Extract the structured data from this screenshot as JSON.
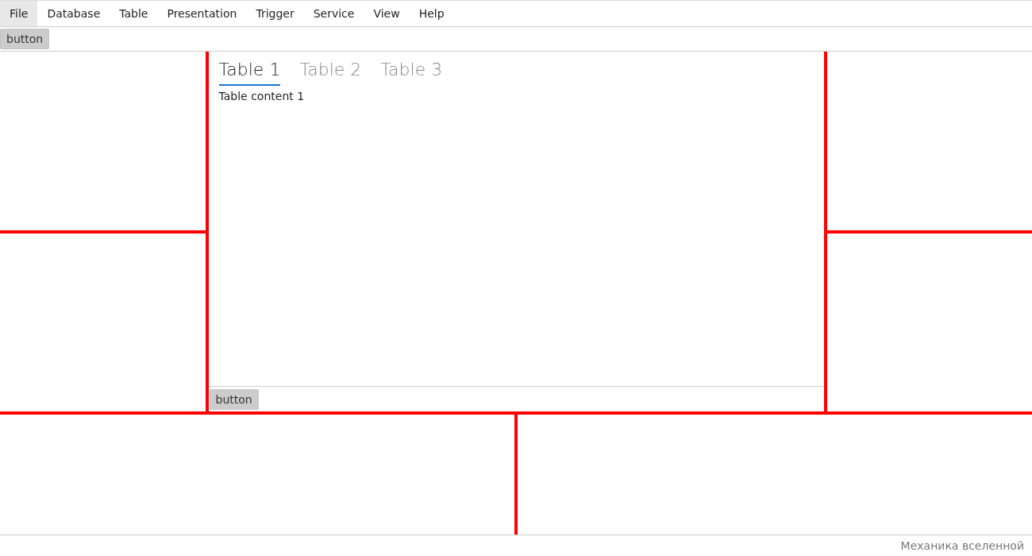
{
  "menu": [
    {
      "label": "File",
      "selected": true
    },
    {
      "label": "Database",
      "selected": false
    },
    {
      "label": "Table",
      "selected": false
    },
    {
      "label": "Presentation",
      "selected": false
    },
    {
      "label": "Trigger",
      "selected": false
    },
    {
      "label": "Service",
      "selected": false
    },
    {
      "label": "View",
      "selected": false
    },
    {
      "label": "Help",
      "selected": false
    }
  ],
  "toolbar": {
    "button": "button"
  },
  "tabs": [
    {
      "label": "Table 1",
      "selected": true
    },
    {
      "label": "Table 2",
      "selected": false
    },
    {
      "label": "Table 3",
      "selected": false
    }
  ],
  "tab_content": "Table content 1",
  "center_footer": {
    "button": "button"
  },
  "status_bar": "Механика вселенной"
}
